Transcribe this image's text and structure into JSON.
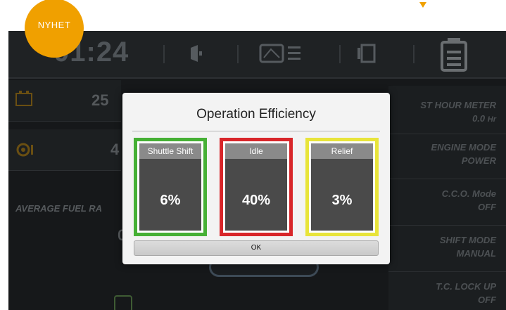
{
  "badge": {
    "label": "NYHET"
  },
  "dashboard": {
    "time": "01:24",
    "battery_value": "25",
    "engine_value": "4",
    "fuel_label": "AVERAGE FUEL RA",
    "fuel_value": "0",
    "right_panel": [
      {
        "label": "ST HOUR METER",
        "value": "0.0",
        "unit": "Hr"
      },
      {
        "label": "ENGINE MODE",
        "value": "POWER"
      },
      {
        "label": "C.C.O. Mode",
        "value": "OFF"
      },
      {
        "label": "SHIFT MODE",
        "value": "MANUAL"
      },
      {
        "label": "T.C. LOCK UP",
        "value": "OFF"
      }
    ]
  },
  "dialog": {
    "title": "Operation Efficiency",
    "ok_label": "OK",
    "cards": [
      {
        "label": "Shuttle Shift",
        "value": "6%",
        "border_color": "#46b035"
      },
      {
        "label": "Idle",
        "value": "40%",
        "border_color": "#d8262a"
      },
      {
        "label": "Relief",
        "value": "3%",
        "border_color": "#e8e43a"
      }
    ]
  },
  "colors": {
    "accent": "#f0a000",
    "background": "#16181a"
  }
}
